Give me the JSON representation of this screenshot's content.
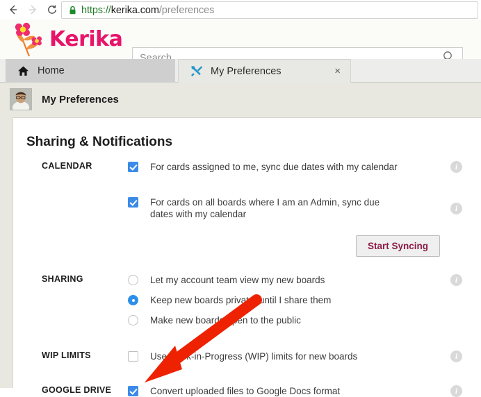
{
  "browser": {
    "back_icon": "arrow-left-icon",
    "forward_icon": "arrow-right-icon",
    "reload_icon": "reload-icon",
    "lock_icon": "lock-icon",
    "url_scheme": "https://",
    "url_host": "kerika.com",
    "url_path": "/preferences",
    "url_full": "https://kerika.com/preferences"
  },
  "app": {
    "logo_text": "Kerika",
    "logo_icon": "flower-icon",
    "brand_color": "#e8146b",
    "search": {
      "placeholder": "Search",
      "value": "",
      "icon": "search-icon"
    }
  },
  "tabs": [
    {
      "label": "Home",
      "icon": "home-icon",
      "active": false,
      "closable": false
    },
    {
      "label": "My Preferences",
      "icon": "tools-icon",
      "active": true,
      "closable": true,
      "close_glyph": "×"
    }
  ],
  "page": {
    "title": "My Preferences",
    "avatar_icon": "user-avatar",
    "panel_heading": "Sharing & Notifications"
  },
  "settings": {
    "info_glyph": "i",
    "groups": [
      {
        "label": "CALENDAR",
        "options": [
          {
            "type": "checkbox",
            "checked": true,
            "text": "For cards assigned to me, sync due dates with my calendar",
            "info": true
          },
          {
            "type": "checkbox",
            "checked": true,
            "text": "For cards on all boards where I am an Admin, sync due dates with my calendar",
            "info": true
          }
        ],
        "button": {
          "label": "Start Syncing",
          "text_color": "#8b1b46"
        }
      },
      {
        "label": "SHARING",
        "options": [
          {
            "type": "radio",
            "checked": false,
            "text": "Let my account team view my new boards",
            "info": true
          },
          {
            "type": "radio",
            "checked": true,
            "text": "Keep new boards private, until I share them",
            "info": false
          },
          {
            "type": "radio",
            "checked": false,
            "text": "Make new boards open to the public",
            "info": false
          }
        ]
      },
      {
        "label": "WIP LIMITS",
        "options": [
          {
            "type": "checkbox",
            "checked": false,
            "text": "Use Work-in-Progress (WIP) limits for new boards",
            "info": true
          }
        ]
      },
      {
        "label": "GOOGLE DRIVE",
        "options": [
          {
            "type": "checkbox",
            "checked": true,
            "text": "Convert uploaded files to Google Docs format",
            "info": true
          }
        ]
      }
    ]
  },
  "annotation": {
    "arrow_color": "#ee2200",
    "arrow_name": "red-pointer-arrow"
  },
  "colors": {
    "checkbox_blue": "#3b8ae8",
    "radio_blue": "#2d8fea",
    "page_background": "#e8e8e0",
    "panel_background": "#ffffff"
  }
}
